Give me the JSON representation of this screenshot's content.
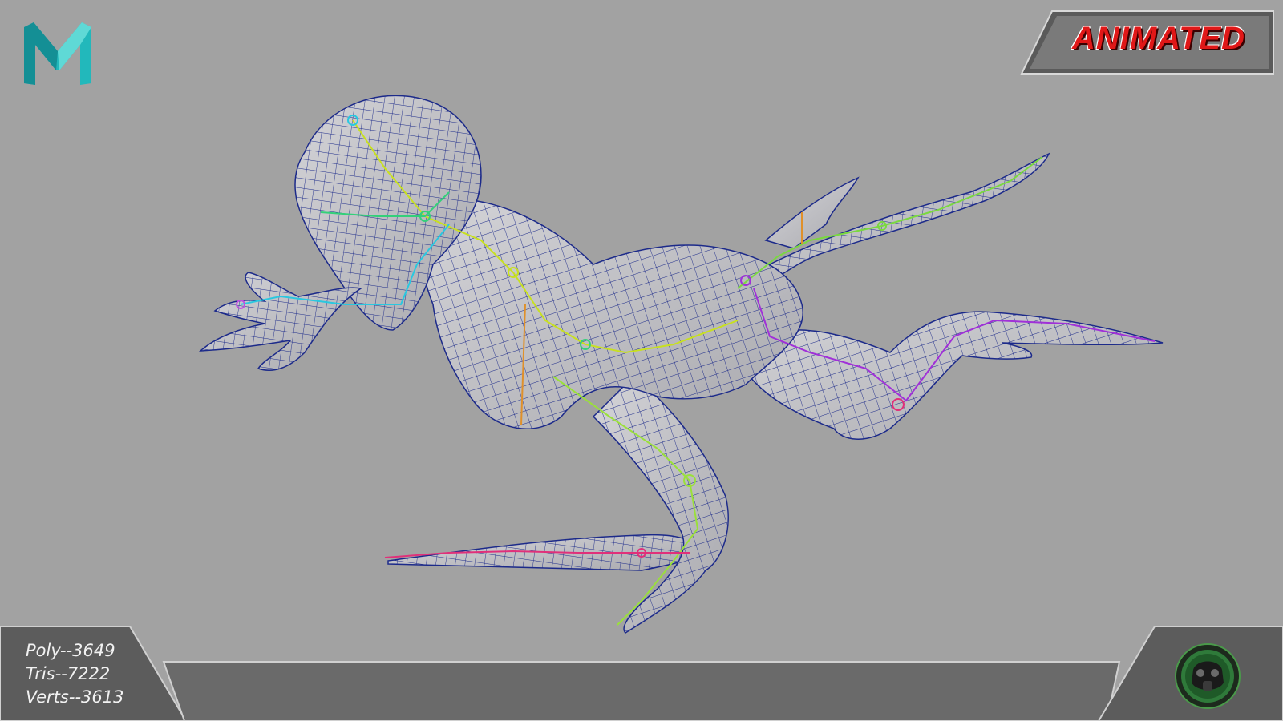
{
  "app": {
    "logo_letter": "M",
    "logo_icon": "maya-logo-icon"
  },
  "badge": {
    "text": "ANIMATED",
    "color": "#e01818"
  },
  "stats": {
    "poly": "Poly--3649",
    "tris": "Tris--7222",
    "verts": "Verts--3613"
  },
  "creator": {
    "icon": "gas-mask-icon"
  },
  "colors": {
    "background": "#a2a2a2",
    "mesh_fill": "#c9c9cc",
    "wireframe": "#1c2a8a",
    "logo_teal": "#1fb6b8",
    "badge_red": "#e01818"
  }
}
